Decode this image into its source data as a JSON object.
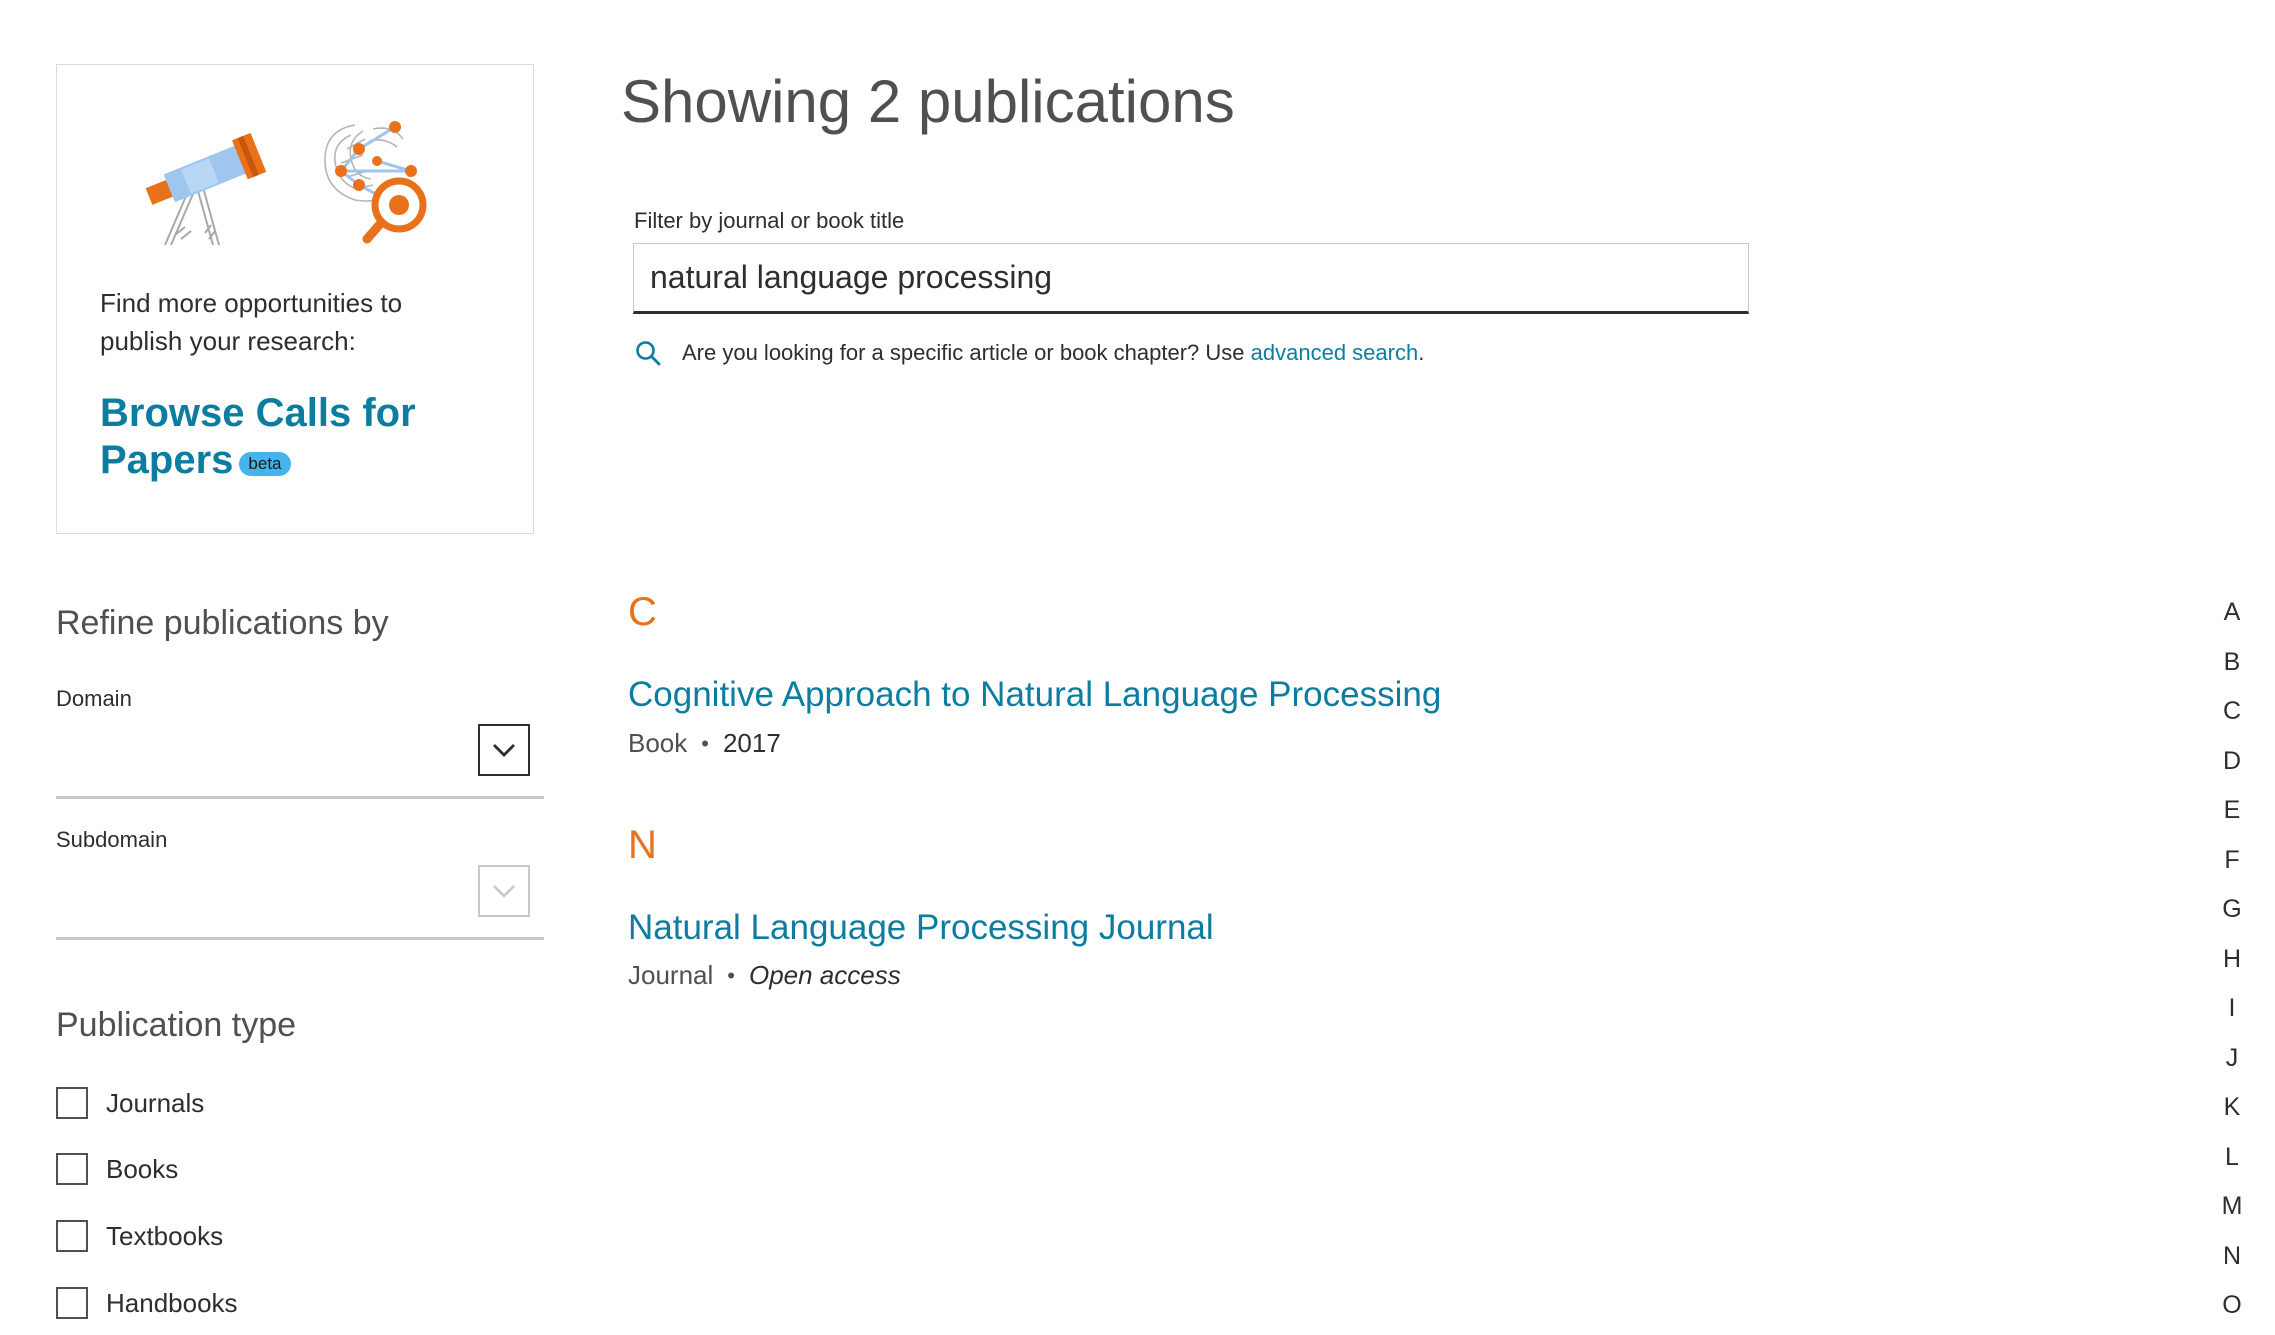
{
  "promo": {
    "text": "Find more opportunities to publish your research:",
    "link_label": "Browse Calls for Papers",
    "badge": "beta"
  },
  "heading": "Showing 2 publications",
  "filter": {
    "label": "Filter by journal or book title",
    "value": "natural language processing",
    "hint_prefix": "Are you looking for a specific article or book chapter? Use",
    "hint_link": "advanced search",
    "hint_suffix": "."
  },
  "refine": {
    "title": "Refine publications by",
    "domain_label": "Domain",
    "domain_value": "",
    "subdomain_label": "Subdomain",
    "subdomain_value": ""
  },
  "publication_type": {
    "title": "Publication type",
    "options": [
      "Journals",
      "Books",
      "Textbooks",
      "Handbooks"
    ]
  },
  "results": [
    {
      "letter": "C",
      "title": "Cognitive Approach to Natural Language Processing",
      "type": "Book",
      "detail": "2017",
      "detail_style": "year"
    },
    {
      "letter": "N",
      "title": "Natural Language Processing Journal",
      "type": "Journal",
      "detail": "Open access",
      "detail_style": "access"
    }
  ],
  "alphabet": [
    "A",
    "B",
    "C",
    "D",
    "E",
    "F",
    "G",
    "H",
    "I",
    "J",
    "K",
    "L",
    "M",
    "N",
    "O"
  ],
  "colors": {
    "link": "#0c7da0",
    "accent_orange": "#e9711c",
    "beta_badge": "#44b4eb"
  },
  "icons": {
    "search_hint": "search-icon",
    "select": "chevron-down-icon",
    "promo": "telescope-and-research-network-illustration"
  }
}
